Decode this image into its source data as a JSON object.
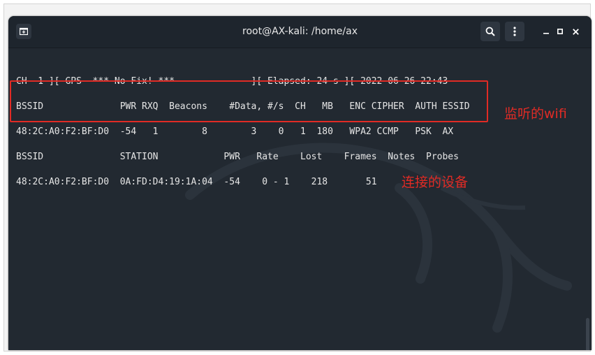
{
  "window": {
    "title": "root@AX-kali: /home/ax"
  },
  "icons": {
    "new_tab": "new-tab-icon",
    "search": "search-icon",
    "menu": "kebab-menu-icon",
    "minimize": "minimize-icon",
    "maximize": "maximize-icon",
    "close": "close-icon"
  },
  "terminal": {
    "lines": [
      "CH  1 ][ GPS  *** No Fix! ***              ][ Elapsed: 24 s ][ 2022-06-26 22:43",
      "BSSID              PWR RXQ  Beacons    #Data, #/s  CH   MB   ENC CIPHER  AUTH ESSID",
      "48:2C:A0:F2:BF:D0  -54   1        8        3    0   1  180   WPA2 CCMP   PSK  AX",
      "BSSID              STATION            PWR   Rate    Lost    Frames  Notes  Probes",
      "48:2C:A0:F2:BF:D0  0A:FD:D4:19:1A:04  -54    0 - 1    218       51"
    ]
  },
  "annotations": {
    "monitored_wifi": "监听的wifi",
    "connected_devices": "连接的设备"
  },
  "colors": {
    "terminal_bg": "#222931",
    "annotation_red": "#e12b25"
  }
}
